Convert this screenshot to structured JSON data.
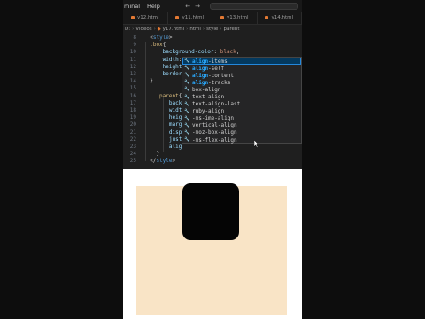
{
  "menubar": {
    "items": [
      "minal",
      "Help"
    ],
    "nav": [
      "←",
      "→"
    ]
  },
  "tabs": [
    {
      "label": "y12.html"
    },
    {
      "label": "y11.html"
    },
    {
      "label": "y13.html"
    },
    {
      "label": "y14.html"
    }
  ],
  "breadcrumb": {
    "items": [
      "D:",
      "Videos",
      "y17.html",
      "html",
      "style",
      "parent"
    ]
  },
  "code": {
    "lines": [
      {
        "n": "8",
        "tokens": [
          {
            "c": "punc",
            "t": "  <"
          },
          {
            "c": "tag",
            "t": "style"
          },
          {
            "c": "punc",
            "t": ">"
          }
        ]
      },
      {
        "n": "9",
        "tokens": [
          {
            "c": "sel",
            "t": "  .box"
          },
          {
            "c": "punc",
            "t": "{"
          }
        ]
      },
      {
        "n": "10",
        "tokens": [
          {
            "c": "prop",
            "t": "      background-color"
          },
          {
            "c": "punc",
            "t": ": "
          },
          {
            "c": "val",
            "t": "black"
          },
          {
            "c": "punc",
            "t": ";"
          }
        ]
      },
      {
        "n": "11",
        "tokens": [
          {
            "c": "prop",
            "t": "      width"
          },
          {
            "c": "punc",
            "t": ":15"
          }
        ]
      },
      {
        "n": "12",
        "tokens": [
          {
            "c": "prop",
            "t": "      height"
          },
          {
            "c": "punc",
            "t": ":1"
          }
        ]
      },
      {
        "n": "13",
        "tokens": [
          {
            "c": "prop",
            "t": "      border-r"
          }
        ]
      },
      {
        "n": "14",
        "tokens": [
          {
            "c": "punc",
            "t": "  }"
          }
        ]
      },
      {
        "n": "15",
        "tokens": []
      },
      {
        "n": "16",
        "tokens": [
          {
            "c": "sel",
            "t": "    .parent"
          },
          {
            "c": "punc",
            "t": "{"
          }
        ]
      },
      {
        "n": "17",
        "tokens": [
          {
            "c": "prop",
            "t": "        back"
          }
        ]
      },
      {
        "n": "18",
        "tokens": [
          {
            "c": "prop",
            "t": "        widt"
          }
        ]
      },
      {
        "n": "19",
        "tokens": [
          {
            "c": "prop",
            "t": "        heig"
          }
        ]
      },
      {
        "n": "20",
        "tokens": [
          {
            "c": "prop",
            "t": "        marg"
          }
        ]
      },
      {
        "n": "21",
        "tokens": [
          {
            "c": "prop",
            "t": "        disp"
          }
        ]
      },
      {
        "n": "22",
        "tokens": [
          {
            "c": "prop",
            "t": "        just"
          }
        ]
      },
      {
        "n": "23",
        "tokens": [
          {
            "c": "prop",
            "t": "        alig"
          }
        ]
      },
      {
        "n": "24",
        "tokens": [
          {
            "c": "punc",
            "t": "    }"
          }
        ]
      },
      {
        "n": "25",
        "tokens": [
          {
            "c": "punc",
            "t": "  </"
          },
          {
            "c": "tag",
            "t": "style"
          },
          {
            "c": "punc",
            "t": ">"
          }
        ]
      }
    ]
  },
  "suggestions": [
    {
      "match": "align",
      "rest": "-items",
      "active": true
    },
    {
      "match": "align",
      "rest": "-self"
    },
    {
      "match": "align",
      "rest": "-content"
    },
    {
      "match": "align",
      "rest": "-tracks"
    },
    {
      "match": "",
      "rest": "box-align"
    },
    {
      "match": "",
      "rest": "text-align"
    },
    {
      "match": "",
      "rest": "text-align-last"
    },
    {
      "match": "",
      "rest": "ruby-align"
    },
    {
      "match": "",
      "rest": "-ms-ime-align"
    },
    {
      "match": "",
      "rest": "vertical-align"
    },
    {
      "match": "",
      "rest": "-moz-box-align"
    },
    {
      "match": "",
      "rest": "-ms-flex-align"
    }
  ],
  "colors": {
    "editor_bg": "#1f1f1f",
    "parent_bg": "#f9e4c6",
    "box_bg": "#050505",
    "accent": "#2aaaff"
  }
}
